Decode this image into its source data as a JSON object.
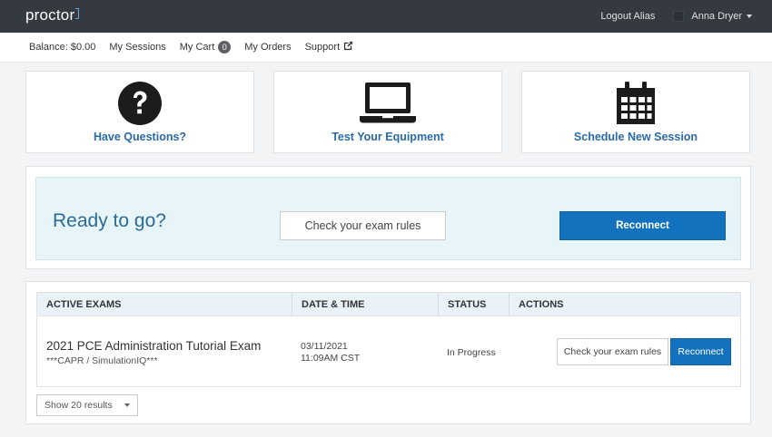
{
  "app": {
    "logo_text": "proctor"
  },
  "topnav": {
    "logout_label": "Logout Alias",
    "user_name": "Anna Dryer"
  },
  "subnav": {
    "balance": "Balance: $0.00",
    "sessions": "My Sessions",
    "cart": "My Cart",
    "cart_count": "0",
    "orders": "My Orders",
    "support": "Support"
  },
  "tiles": [
    {
      "label": "Have Questions?",
      "icon": "question-circle-icon"
    },
    {
      "label": "Test Your Equipment",
      "icon": "laptop-icon"
    },
    {
      "label": "Schedule New Session",
      "icon": "calendar-icon"
    }
  ],
  "ready": {
    "title": "Ready to go?",
    "rules_button": "Check your exam rules",
    "reconnect_button": "Reconnect"
  },
  "exams_table": {
    "columns": [
      "ACTIVE EXAMS",
      "DATE & TIME",
      "STATUS",
      "ACTIONS"
    ],
    "rows": [
      {
        "name": "2021 PCE Administration Tutorial Exam",
        "subtitle": "***CAPR / SimulationIQ***",
        "date": "03/11/2021",
        "time": "11:09AM CST",
        "status": "In Progress",
        "rules_button": "Check your exam rules",
        "reconnect_button": "Reconnect"
      }
    ]
  },
  "results_select": {
    "value": "Show 20 results"
  },
  "colors": {
    "topbar": "#343a40",
    "accent_blue": "#1372bd",
    "tile_label": "#2a6aa6",
    "ready_bg": "#e7f4f8",
    "table_header_bg": "#e9f2f7"
  }
}
